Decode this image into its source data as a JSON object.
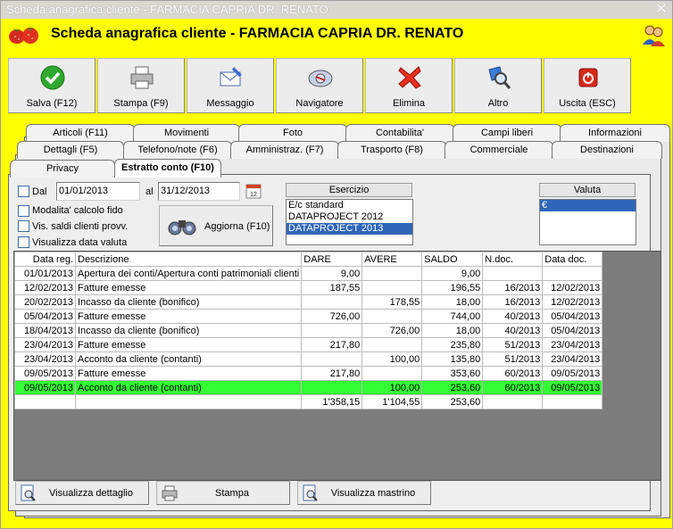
{
  "window": {
    "title": "Scheda anagrafica cliente - FARMACIA CAPRIA DR. RENATO",
    "close_glyph": "✕"
  },
  "header": {
    "title": "Scheda anagrafica cliente - FARMACIA CAPRIA DR. RENATO"
  },
  "toolbar": {
    "save": "Salva (F12)",
    "print": "Stampa (F9)",
    "message": "Messaggio",
    "navigator": "Navigatore",
    "delete": "Elimina",
    "other": "Altro",
    "exit": "Uscita (ESC)"
  },
  "tabs": {
    "row1": [
      "Articoli (F11)",
      "Movimenti",
      "Foto",
      "Contabilita'",
      "Campi liberi",
      "Informazioni"
    ],
    "row2": [
      "Dettagli (F5)",
      "Telefono/note (F6)",
      "Amministraz. (F7)",
      "Trasporto (F8)",
      "Commerciale",
      "Destinazioni"
    ],
    "row3": [
      "Privacy",
      "Estratto conto (F10)"
    ]
  },
  "filters": {
    "dal_label": "Dal",
    "date_from": "01/01/2013",
    "al_label": "al",
    "date_to": "31/12/2013",
    "opt1": "Modalita' calcolo fido",
    "opt2": "Vis. saldi clienti provv.",
    "opt3": "Visualizza data valuta",
    "refresh_button": "Aggiorna (F10)"
  },
  "esercizio": {
    "header": "Esercizio",
    "items": [
      "E/c standard",
      "DATAPROJECT 2012",
      "DATAPROJECT 2013"
    ],
    "selected": "DATAPROJECT 2013"
  },
  "valuta": {
    "header": "Valuta",
    "items": [
      "€"
    ]
  },
  "grid": {
    "columns": [
      "Data reg.",
      "Descrizione",
      "DARE",
      "AVERE",
      "SALDO",
      "N.doc.",
      "Data doc."
    ],
    "rows": [
      [
        "01/01/2013",
        "Apertura dei conti/Apertura conti patrimoniali clienti",
        "9,00",
        "",
        "9,00",
        "",
        ""
      ],
      [
        "12/02/2013",
        "Fatture emesse",
        "187,55",
        "",
        "196,55",
        "16/2013",
        "12/02/2013"
      ],
      [
        "20/02/2013",
        "Incasso da cliente (bonifico)",
        "",
        "178,55",
        "18,00",
        "16/2013",
        "12/02/2013"
      ],
      [
        "05/04/2013",
        "Fatture emesse",
        "726,00",
        "",
        "744,00",
        "40/2013",
        "05/04/2013"
      ],
      [
        "18/04/2013",
        "Incasso da cliente (bonifico)",
        "",
        "726,00",
        "18,00",
        "40/2013",
        "05/04/2013"
      ],
      [
        "23/04/2013",
        "Fatture emesse",
        "217,80",
        "",
        "235,80",
        "51/2013",
        "23/04/2013"
      ],
      [
        "23/04/2013",
        "Acconto da cliente (contanti)",
        "",
        "100,00",
        "135,80",
        "51/2013",
        "23/04/2013"
      ],
      [
        "09/05/2013",
        "Fatture emesse",
        "217,80",
        "",
        "353,60",
        "60/2013",
        "09/05/2013"
      ],
      [
        "09/05/2013",
        "Acconto da cliente (contanti)",
        "",
        "100,00",
        "253,60",
        "60/2013",
        "09/05/2013"
      ]
    ],
    "highlight_row": 8,
    "highlight_color": "#33ff33",
    "totals": [
      "",
      "",
      "1'358,15",
      "1'104,55",
      "253,60",
      "",
      ""
    ]
  },
  "bottom": {
    "detail": "Visualizza dettaglio",
    "print": "Stampa",
    "ledger": "Visualizza mastrino"
  },
  "colors": {
    "background": "#ffff00",
    "selection": "#3066b8"
  }
}
